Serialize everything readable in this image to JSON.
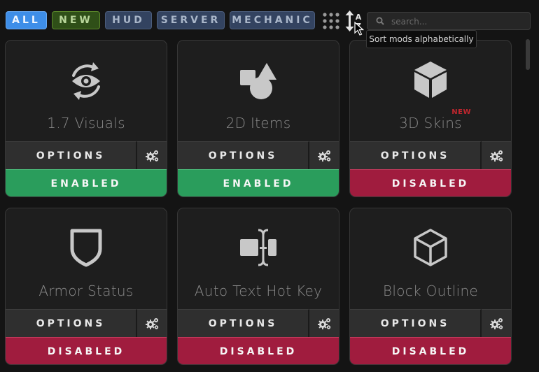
{
  "filters": [
    {
      "label": "ALL"
    },
    {
      "label": "NEW"
    },
    {
      "label": "HUD"
    },
    {
      "label": "SERVER"
    },
    {
      "label": "MECHANIC"
    }
  ],
  "search": {
    "placeholder": "search..."
  },
  "tooltip": {
    "text": "Sort mods alphabetically"
  },
  "mods": [
    {
      "name": "1.7 Visuals",
      "icon": "eye-refresh-icon",
      "options_label": "OPTIONS",
      "status": "ENABLED",
      "new": ""
    },
    {
      "name": "2D Items",
      "icon": "shapes-icon",
      "options_label": "OPTIONS",
      "status": "ENABLED",
      "new": ""
    },
    {
      "name": "3D Skins",
      "icon": "solid-cube-icon",
      "options_label": "OPTIONS",
      "status": "DISABLED",
      "new": "NEW"
    },
    {
      "name": "Armor Status",
      "icon": "shield-icon",
      "options_label": "OPTIONS",
      "status": "DISABLED",
      "new": ""
    },
    {
      "name": "Auto Text Hot Key",
      "icon": "text-cursor-icon",
      "options_label": "OPTIONS",
      "status": "DISABLED",
      "new": ""
    },
    {
      "name": "Block Outline",
      "icon": "outline-cube-icon",
      "options_label": "OPTIONS",
      "status": "DISABLED",
      "new": ""
    }
  ],
  "colors": {
    "enabled": "#2a9d5c",
    "disabled": "#a01c3e",
    "accent": "#3e8ee8"
  }
}
